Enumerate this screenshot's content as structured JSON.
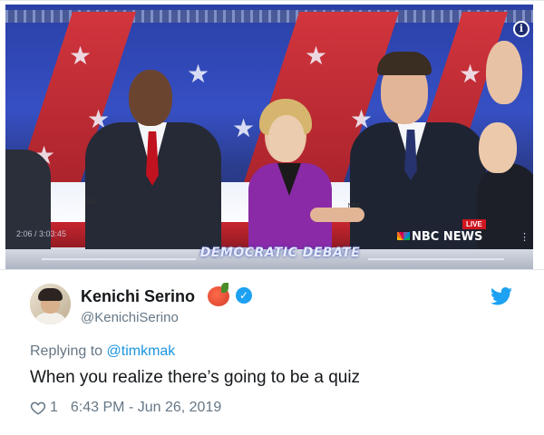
{
  "video": {
    "banner_text": "DEMOCRATIC DEBATE",
    "timecode": "2:06 / 3:03:45",
    "live_badge": "LIVE",
    "network": "NBC NEWS",
    "icons": [
      "info-icon",
      "more-options-icon"
    ]
  },
  "author": {
    "display_name": "Kenichi Serino",
    "handle": "@KenichiSerino",
    "emoji": "tomato-emoji",
    "verified": true
  },
  "reply": {
    "prefix": "Replying to",
    "to_handle": "@timkmak"
  },
  "tweet": {
    "text": "When you realize there’s going to be a quiz",
    "likes": "1",
    "timestamp": "6:43 PM - Jun 26, 2019"
  },
  "colors": {
    "twitter_blue": "#1da1f2",
    "link_blue": "#1b95e0",
    "secondary_text": "#657786",
    "primary_text": "#14171a"
  }
}
